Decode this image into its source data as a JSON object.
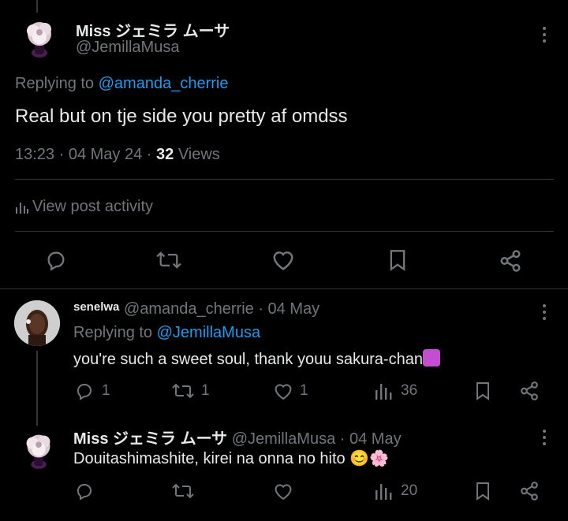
{
  "main_tweet": {
    "display_name": "Miss ジェミラ ムーサ",
    "handle": "@JemillaMusa",
    "replying_label": "Replying to",
    "replying_to": "@amanda_cherrie",
    "text": "Real but on tje side you pretty af omdss",
    "time": "13:23 · 04 May 24 ·",
    "views_count": "32",
    "views_label": "Views",
    "activity_label": "View post activity"
  },
  "reply_1": {
    "display_name": "senelwa",
    "handle": "@amanda_cherrie",
    "date": "· 04 May",
    "replying_label": "Replying to",
    "replying_to": "@JemillaMusa",
    "text": "you're such a sweet soul, thank youu sakura-chan",
    "emoji": "💟",
    "reply_count": "1",
    "retweet_count": "1",
    "like_count": "1",
    "view_count": "36"
  },
  "reply_2": {
    "display_name": "Miss ジェミラ ムーサ",
    "handle": "@JemillaMusa",
    "date": "· 04 May",
    "text": "Douitashimashite, kirei na onna no hito",
    "emoji": "😊🌸",
    "view_count": "20"
  },
  "icons": [
    "more-icon",
    "reply-icon",
    "retweet-icon",
    "like-icon",
    "bookmark-icon",
    "share-icon",
    "analytics-icon"
  ],
  "colors": {
    "background": "#000000",
    "text": "#e7e9ea",
    "muted": "#71767b",
    "link": "#1d9bf0",
    "divider": "#2f3336"
  }
}
